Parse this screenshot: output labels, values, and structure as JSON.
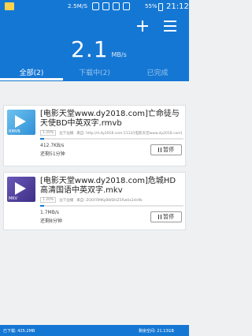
{
  "status_bar": {
    "network_speed": "2.5M/S",
    "battery_percent": "55%",
    "time": "21:12"
  },
  "header": {
    "speed_value": "2.1",
    "speed_unit": "MB/s"
  },
  "tabs": [
    {
      "label": "全部(2)",
      "active": true
    },
    {
      "label": "下载中(2)",
      "active": false
    },
    {
      "label": "已完成",
      "active": false
    }
  ],
  "downloads": [
    {
      "title": "[电影天堂www.dy2018.com]亡命徒与天使BD中英双字.rmvb",
      "format": "RMVB",
      "percent": "1.20%",
      "source_label": "边下边播",
      "source_url": "来自: http://d.dy2018.com:2112/[电影天堂www.dy2018.com]",
      "progress": 0.012,
      "rate": "412.7KB/s",
      "remaining": "还剩51分钟",
      "action": "暂停"
    },
    {
      "title": "[电影天堂www.dy2018.com]危城HD高清国语中英双字.mkv",
      "format": "MKV",
      "percent": "1.20%",
      "source_label": "边下边播",
      "source_url": "来自: ZOOFRMKyBWDHZ5Rw0x2dn9k",
      "progress": 0.012,
      "rate": "1.7MB/s",
      "remaining": "还剩8分钟",
      "action": "暂停"
    }
  ],
  "footer": {
    "storage": "已下载: 425.2MB",
    "usage": "剩余空间: 21.13GB"
  },
  "colors": {
    "primary": "#1577d4",
    "background": "#eef0f2"
  }
}
